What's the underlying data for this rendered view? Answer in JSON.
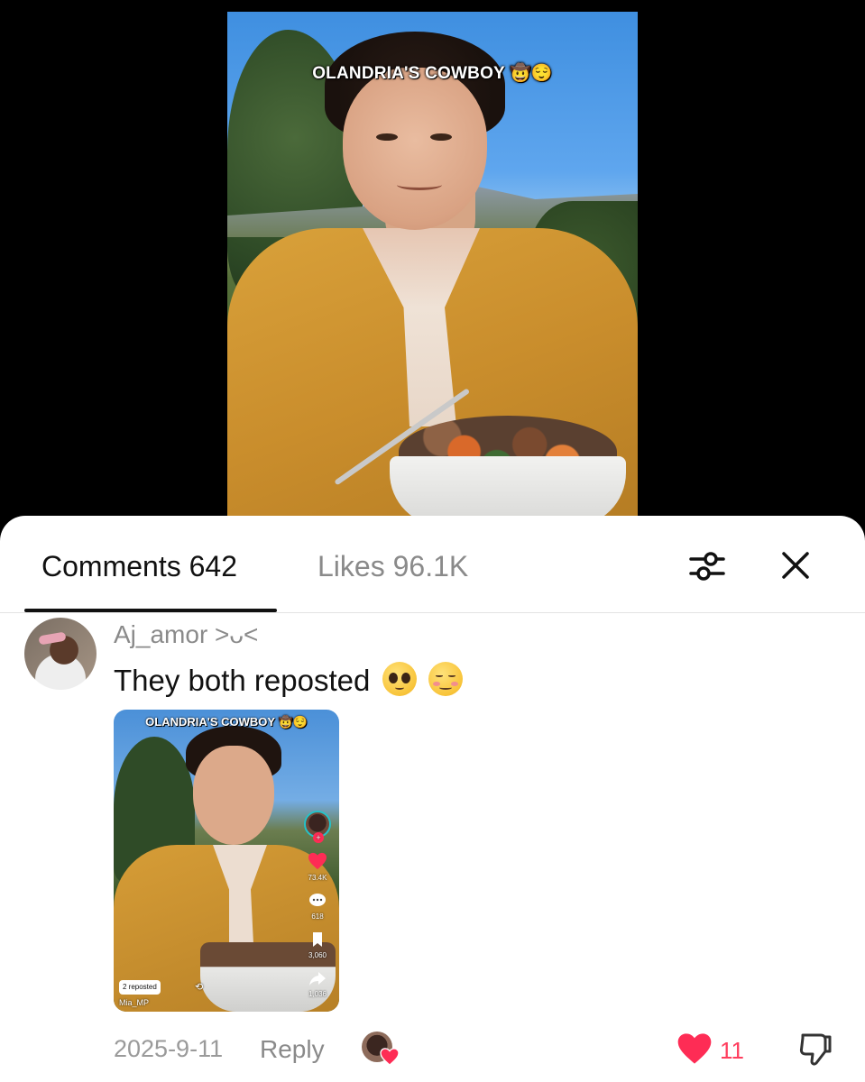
{
  "video": {
    "caption": "OLANDRIA'S COWBOY 🤠😌"
  },
  "tabs": {
    "comments_label": "Comments 642",
    "likes_label": "Likes 96.1K"
  },
  "toolbar": {
    "filter_icon": "sliders-icon",
    "close_icon": "close-icon"
  },
  "comment": {
    "username": "Aj_amor ˃ᴗ˂",
    "text": "They both reposted",
    "emojis": [
      "pleading-face",
      "smiling-blush-face"
    ],
    "date": "2025-9-11",
    "reply_label": "Reply",
    "like_count": "11",
    "like_color": "#fe2c55",
    "embedded_video": {
      "caption": "OLANDRIA'S COWBOY 🤠😌",
      "likes": "73.4K",
      "comments": "618",
      "saves": "3,060",
      "shares": "1,036",
      "reposted_label": "2 reposted",
      "author": "Mia_MP"
    }
  }
}
